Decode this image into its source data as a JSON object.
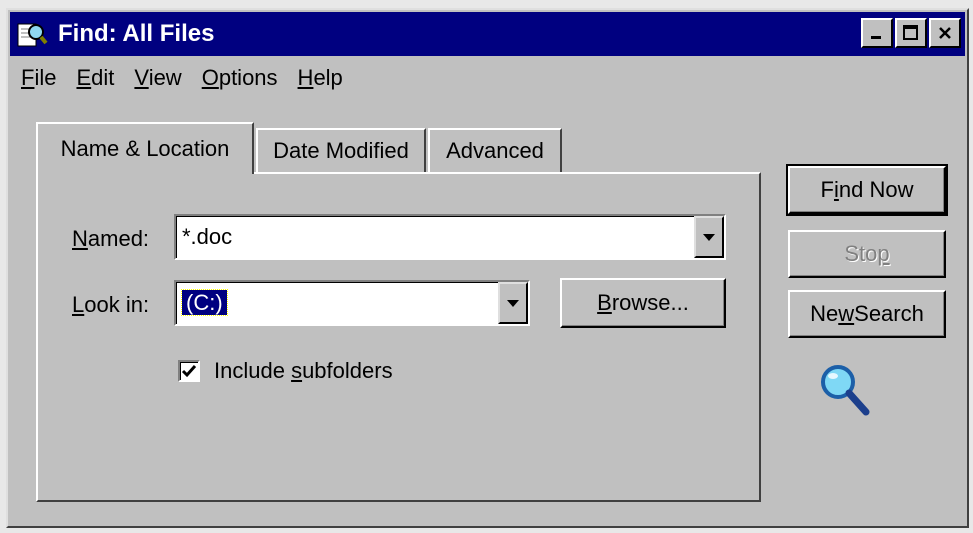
{
  "window": {
    "title": "Find: All Files",
    "icon": "find-magnifier-icon"
  },
  "menubar": {
    "items": [
      {
        "label": "File",
        "mnemonic": "F",
        "rest": "ile"
      },
      {
        "label": "Edit",
        "mnemonic": "E",
        "rest": "dit"
      },
      {
        "label": "View",
        "mnemonic": "V",
        "rest": "iew"
      },
      {
        "label": "Options",
        "mnemonic": "O",
        "rest": "ptions"
      },
      {
        "label": "Help",
        "mnemonic": "H",
        "rest": "elp"
      }
    ]
  },
  "tabs": [
    {
      "label": "Name & Location",
      "active": true
    },
    {
      "label": "Date Modified",
      "active": false
    },
    {
      "label": "Advanced",
      "active": false
    }
  ],
  "form": {
    "named_label_mn": "N",
    "named_label_rest": "amed:",
    "named_value": "*.doc",
    "lookin_label_mn": "L",
    "lookin_label_rest": "ook in:",
    "lookin_value": "(C:)",
    "browse_mn": "B",
    "browse_rest": "rowse...",
    "include_subfolders_pre": "Include ",
    "include_subfolders_mn": "s",
    "include_subfolders_rest": "ubfolders",
    "include_subfolders_checked": true
  },
  "actions": {
    "find_now_pre": "F",
    "find_now_mn": "i",
    "find_now_rest": "nd Now",
    "stop_pre": "Sto",
    "stop_mn": "p",
    "new_search_pre": "Ne",
    "new_search_mn": "w",
    "new_search_rest": " Search"
  },
  "colors": {
    "titlebar": "#000080",
    "face": "#c0c0c0",
    "selection": "#000080"
  }
}
